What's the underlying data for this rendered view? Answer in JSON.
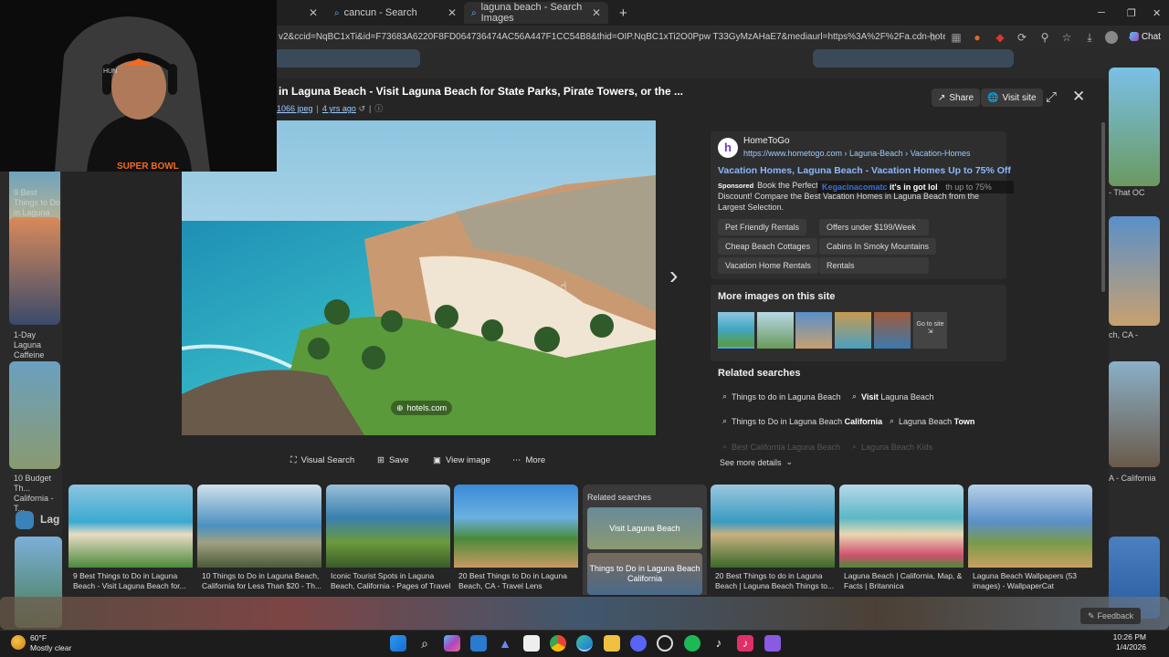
{
  "tabs": [
    {
      "label": "cancun - Search"
    },
    {
      "label": "laguna beach - Search Images"
    }
  ],
  "tab_new_icon": "plus-icon",
  "url": "v2&ccid=NqBC1xTi&id=F73683A6220F8FD064736474AC56A447F1CC54B8&thid=OIP.NqBC1xTi2O0Ppw T33GyMzAHaE7&mediaurl=https%3A%2F%2Fa.cdn-hotels.com%...",
  "window_controls": {
    "minimize": "─",
    "restore": "❐",
    "close": "✕"
  },
  "chat_label": "Chat",
  "modal": {
    "title": "in Laguna Beach - Visit Laguna Beach for State Parks, Pirate Towers, or the ...",
    "meta_size": "1066 jpeg",
    "meta_age": "4 yrs ago",
    "share_label": "Share",
    "visit_label": "Visit site",
    "image_credit": "hotels.com",
    "actions": [
      {
        "label": "Visual Search"
      },
      {
        "label": "Save"
      },
      {
        "label": "View image"
      },
      {
        "label": "More"
      }
    ]
  },
  "ad": {
    "brand": "HomeToGo",
    "url": "https://www.hometogo.com › Laguna-Beach › Vacation-Homes",
    "headline": "Vacation Homes, Laguna Beach - Vacation Homes Up to 75% Off",
    "sponsored_label": "Sponsored",
    "body_start": "Book the Perfect V",
    "overlay_name": "Kegacinacomatc",
    "overlay_text": "it's in got lol",
    "body_end": "th up to 75%",
    "body_rest": "Discount! Compare the Best Vacation Homes in Laguna Beach from the Largest Selection.",
    "chips": [
      "Pet Friendly Rentals",
      "Offers under $199/Week",
      "Cheap Beach Cottages",
      "Cabins In Smoky Mountains",
      "Vacation Home Rentals",
      "Rentals"
    ]
  },
  "more_images": {
    "title": "More images on this site",
    "go_to_site": "Go to site"
  },
  "related": {
    "title": "Related searches",
    "items": [
      {
        "pre": "Things to do in Laguna Beach",
        "bold": ""
      },
      {
        "pre": "",
        "bold": "Visit",
        "post": " Laguna Beach"
      },
      {
        "pre": "Things to Do in Laguna Beach ",
        "bold": "California"
      },
      {
        "pre": "Laguna Beach ",
        "bold": "Town"
      }
    ],
    "faded": [
      "Best California Laguna Beach",
      "Laguna Beach Kids"
    ],
    "see_more": "See more details"
  },
  "strip": [
    {
      "cap": "9 Best Things to Do in Laguna Beach - Visit Laguna Beach for..."
    },
    {
      "cap": "10 Things to Do in Laguna Beach, California for Less Than $20 - Th..."
    },
    {
      "cap": "Iconic Tourist Spots in Laguna Beach, California - Pages of Travel"
    },
    {
      "cap": "20 Best Things to Do in Laguna Beach, CA - Travel Lens"
    },
    {
      "cap": "20 Best Things to do in Laguna Beach | Laguna Beach Things to..."
    },
    {
      "cap": "Laguna Beach | California, Map, & Facts | Britannica"
    },
    {
      "cap": "Laguna Beach Wallpapers (53 images) - WallpaperCat"
    }
  ],
  "strip_related": {
    "title": "Related searches",
    "a": "Visit Laguna Beach",
    "b": "Things to Do in Laguna Beach California"
  },
  "background": {
    "caps": [
      "9 Best Things to Do in Laguna Beach for Sta...",
      "1-Day Laguna Caffeine",
      "10 Budget Th... California - T...",
      "Lag",
      "- That OC",
      "ch, CA -",
      "A - California"
    ]
  },
  "feedback": "Feedback",
  "taskbar": {
    "temp": "60°F",
    "weather": "Mostly clear",
    "time": "10:26 PM",
    "date": "1/4/2026"
  },
  "webcam": {
    "shirt_text": "SUPER BOWL",
    "cap_text": "HUN"
  }
}
